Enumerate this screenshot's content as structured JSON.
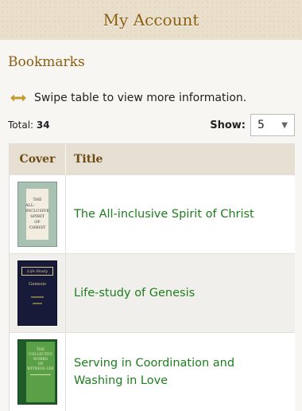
{
  "header": {
    "title": "My Account"
  },
  "section": {
    "title": "Bookmarks"
  },
  "swipe": {
    "text": "Swipe table to view more information.",
    "icon": "left-right-arrow-icon",
    "color": "#c49a2c"
  },
  "total": {
    "label": "Total:",
    "value": "34"
  },
  "show": {
    "label": "Show:",
    "selected": "5"
  },
  "table": {
    "headers": {
      "cover": "Cover",
      "title": "Title"
    },
    "rows": [
      {
        "title": "The All-inclusive Spirit of Christ",
        "cover": {
          "line1": "THE",
          "line2": "ALL-INCLUSIVE",
          "line3": "SPIRIT",
          "line4": "OF",
          "line5": "CHRIST"
        }
      },
      {
        "title": "Life-study of Genesis",
        "cover": {
          "band": "Life-Study",
          "title": "Genesis"
        }
      },
      {
        "title": "Serving in Coordination and Washing in Love",
        "cover": {
          "l1": "THE",
          "l2": "COLLECTED",
          "l3": "WORKS",
          "l4": "OF",
          "l5": "WITNESS LEE"
        }
      }
    ]
  },
  "colors": {
    "accent": "#8a5e10",
    "link": "#1e7d1e",
    "header_bg": "#e9dfcb",
    "table_header_bg": "#e6dfd2"
  }
}
